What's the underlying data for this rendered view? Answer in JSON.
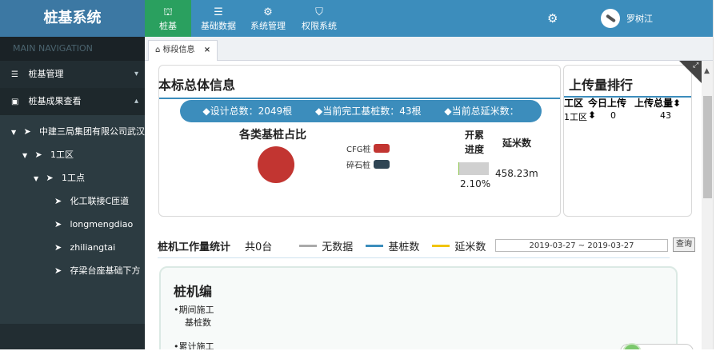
{
  "app": {
    "title": "桩基系统"
  },
  "topnav": [
    {
      "label": "桩基",
      "icon": "pile-driver-icon",
      "active": true
    },
    {
      "label": "基础数据",
      "icon": "database-icon",
      "active": false
    },
    {
      "label": "系统管理",
      "icon": "gears-icon",
      "active": false
    },
    {
      "label": "权限系统",
      "icon": "shield-icon",
      "active": false
    }
  ],
  "user": {
    "name": "罗树江",
    "settings_icon": "gears-icon"
  },
  "sidebar": {
    "header": "MAIN NAVIGATION",
    "menu": [
      {
        "label": "桩基管理",
        "icon": "list-icon",
        "chevron": "»"
      },
      {
        "label": "桩基成果查看",
        "icon": "book-icon",
        "chevron": "«"
      }
    ],
    "tree": [
      {
        "label": "中建三局集团有限公司武汉东",
        "level": 0,
        "expanded": true
      },
      {
        "label": "1工区",
        "level": 1,
        "expanded": true
      },
      {
        "label": "1工点",
        "level": 2,
        "expanded": true
      },
      {
        "label": "化工联接C匝道",
        "level": 3
      },
      {
        "label": "longmengdiao",
        "level": 3
      },
      {
        "label": "zhiliangtai",
        "level": 3
      },
      {
        "label": "存梁台座基础下方",
        "level": 3
      }
    ]
  },
  "tabs": [
    {
      "label": "标段信息",
      "icon": "home-icon",
      "close": "×"
    }
  ],
  "overview": {
    "title": "本标总体信息",
    "summary": {
      "design_total": "◆设计总数：2049根",
      "completed": "◆当前完工基桩数：43根",
      "extension": "◆当前总延米数："
    },
    "pie_title": "各类基桩占比",
    "legend": [
      {
        "label": "CFG桩",
        "color": "#c23531"
      },
      {
        "label": "碎石桩",
        "color": "#2f4554"
      }
    ],
    "progress_head": "开累\n进度",
    "progress_head_1": "开累",
    "progress_head_2": "进度",
    "progress_value": "2.10%",
    "progress_fraction": 0.021,
    "meter_head": "延米数",
    "meter_value": "458.23m"
  },
  "ranking": {
    "title": "上传量排行",
    "columns": [
      "工区",
      "今日上传",
      "上传总量"
    ],
    "rows": [
      {
        "area": "1工区",
        "today": "0",
        "total": "43"
      }
    ]
  },
  "stats": {
    "title": "桩机工作量统计",
    "count": "共0台",
    "legend": [
      {
        "label": "无数据",
        "color": "#aaaaaa"
      },
      {
        "label": "基桩数",
        "color": "#3c8dbc"
      },
      {
        "label": "延米数",
        "color": "#f1c40f"
      }
    ],
    "date_range": "2019-03-27 ~ 2019-03-27",
    "query_label": "查询"
  },
  "machine": {
    "title": "桩机编",
    "line1": "•期间施工",
    "line2": "基桩数",
    "line3": "•累计施工"
  }
}
